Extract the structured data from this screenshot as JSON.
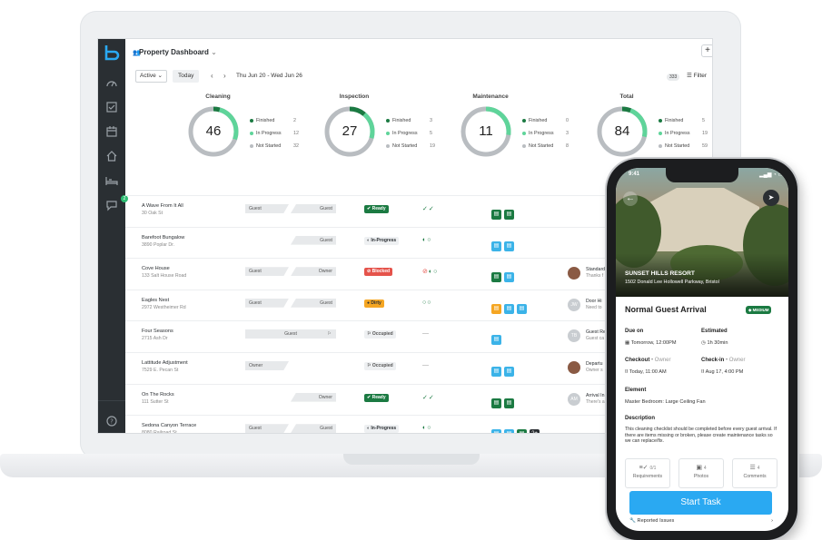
{
  "header": {
    "title": "Property Dashboard",
    "add_label": "+"
  },
  "toolbar": {
    "active_label": "Active",
    "today_label": "Today",
    "prev_label": "‹",
    "next_label": "›",
    "date_range": "Thu Jun 20 - Wed Jun 26",
    "count": "333",
    "filter_label": "Filter"
  },
  "sidebar": {
    "chat_badge": "2"
  },
  "stats": [
    {
      "title": "Cleaning",
      "total": "46",
      "finished": "2",
      "in_progress": "12",
      "not_started": "32"
    },
    {
      "title": "Inspection",
      "total": "27",
      "finished": "3",
      "in_progress": "5",
      "not_started": "19"
    },
    {
      "title": "Maintenance",
      "total": "11",
      "finished": "0",
      "in_progress": "3",
      "not_started": "8"
    },
    {
      "title": "Total",
      "total": "84",
      "finished": "5",
      "in_progress": "19",
      "not_started": "59"
    }
  ],
  "legend": {
    "finished": "Finished",
    "in_progress": "In Progress",
    "not_started": "Not Started"
  },
  "colors": {
    "finished": "#1b7a42",
    "in_progress": "#5fd49a",
    "not_started": "#b9bdc1",
    "accent": "#2aa9f2"
  },
  "rows": [
    {
      "name": "A Wave From It All",
      "addr": "30 Oak St",
      "left": "Guest",
      "right": "Guest",
      "status": "Ready"
    },
    {
      "name": "Barefoot Bungalow",
      "addr": "3890 Poplar Dr.",
      "left": "",
      "right": "Guest",
      "status": "In-Progress"
    },
    {
      "name": "Cove House",
      "addr": "133 Salt House Road",
      "left": "Guest",
      "right": "Owner",
      "status": "Blocked",
      "task_title": "Standard",
      "task_sub": "Thanks f"
    },
    {
      "name": "Eagles Nest",
      "addr": "2972 Westheimer Rd",
      "left": "Guest",
      "right": "Guest",
      "status": "Dirty",
      "task_title": "Door Hi",
      "task_sub": "Need to",
      "avatar": "JW"
    },
    {
      "name": "Four Seasons",
      "addr": "2715 Ash Dr",
      "full": "Guest",
      "status": "Occupied",
      "task_title": "Guest Re",
      "task_sub": "Guest ca",
      "avatar": "TB"
    },
    {
      "name": "Lattitude Adjustment",
      "addr": "7529 E. Pecan St",
      "left": "Owner",
      "right": "",
      "status": "Occupied",
      "task_title": "Departu",
      "task_sub": "Owner s"
    },
    {
      "name": "On The Rocks",
      "addr": "111 Sutter St",
      "left": "",
      "right": "Owner",
      "status": "Ready",
      "task_title": "Arrival In",
      "task_sub": "There's a",
      "avatar": "AM"
    },
    {
      "name": "Sedona Canyon Terrace",
      "addr": "8080 Railroad St",
      "left": "Guest",
      "right": "Guest",
      "status": "In-Progress",
      "more": "2+"
    }
  ],
  "phone": {
    "time": "9:41",
    "property_name": "SUNSET HILLS RESORT",
    "property_addr": "1502 Donald Lee Hollowell Parkway, Bristol",
    "task_title": "Normal Guest Arrival",
    "priority": "MEDIUM",
    "due_label": "Due on",
    "due_value": "Tomorrow, 12:00PM",
    "est_label": "Estimated",
    "est_value": "1h 30min",
    "checkout_label": "Checkout",
    "checkout_sub": "• Owner",
    "checkout_value": "Today, 11:00 AM",
    "checkin_label": "Check-in",
    "checkin_sub": "• Owner",
    "checkin_value": "Aug 17, 4:00 PM",
    "element_label": "Element",
    "element_value": "Master Bedroom: Large Ceiling Fan",
    "desc_label": "Description",
    "desc_value": "This cleaning checklist should be completed before every guest arrival. If there are items missing or broken, please create maintenance tasks so we can replace/fix.",
    "req_count": "0/1",
    "req_label": "Requirements",
    "photos_count": "4",
    "photos_label": "Photos",
    "comments_count": "4",
    "comments_label": "Comments",
    "start_label": "Start Task",
    "reported_label": "Reported Issues"
  }
}
